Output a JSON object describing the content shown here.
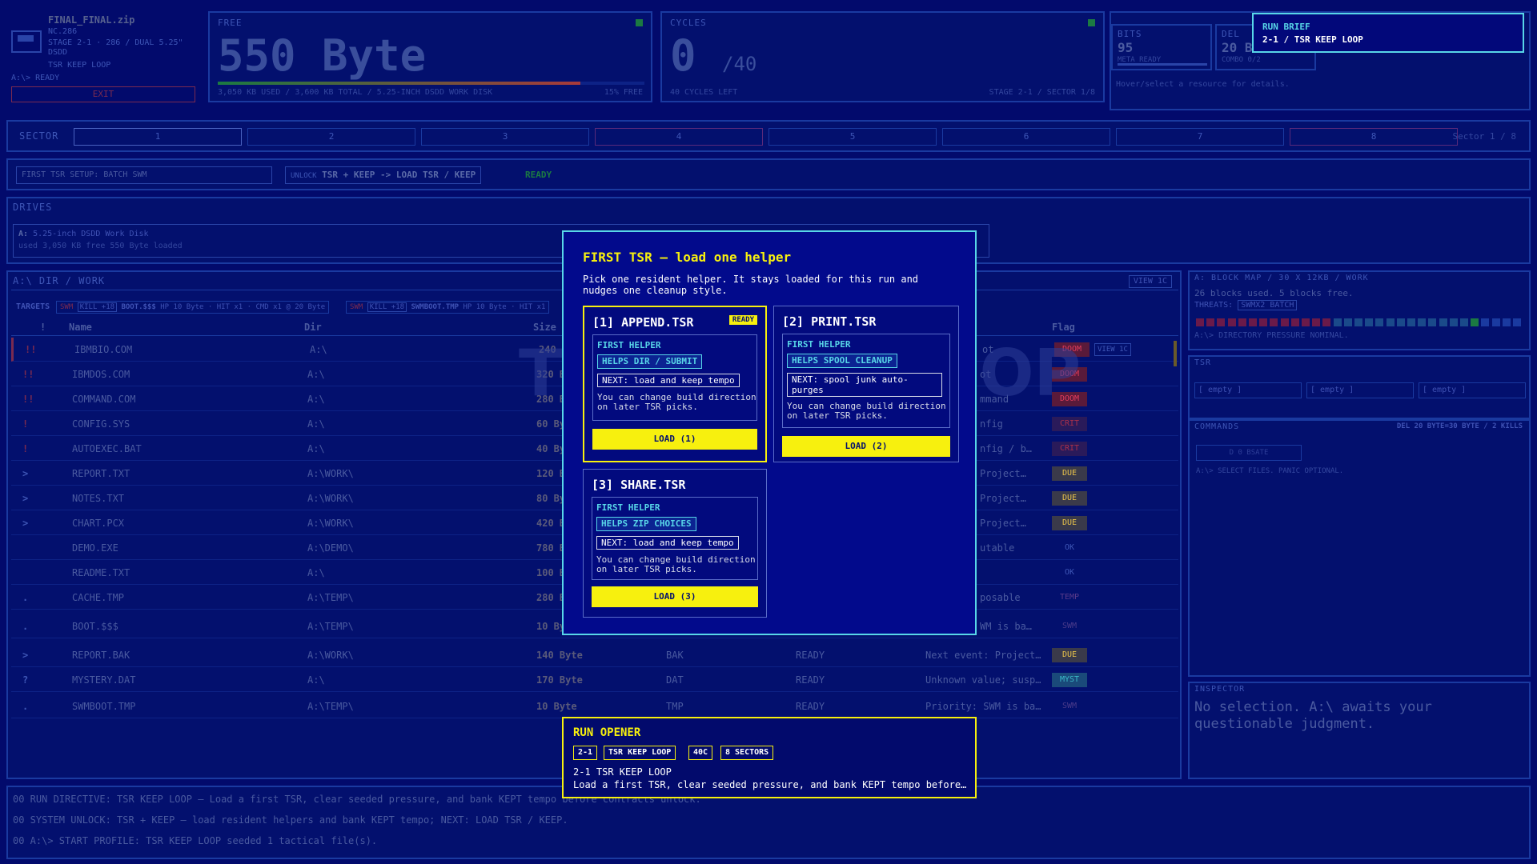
{
  "file": {
    "name": "FINAL_FINAL.zip",
    "code": "NC.286",
    "stage": "STAGE 2-1 · 286 / DUAL 5.25\" DSDD",
    "mode": "TSR KEEP LOOP",
    "prompt": "A:\\> READY",
    "exit": "EXIT"
  },
  "free": {
    "label": "FREE",
    "value": "550 Byte",
    "used": "3,050 KB USED / 3,600 KB TOTAL / 5.25-INCH DSDD WORK DISK",
    "pct": "15% FREE",
    "fill_pct": 85
  },
  "cycles": {
    "label": "CYCLES",
    "value": "0",
    "max": "/40",
    "left": "40 CYCLES LEFT",
    "stage": "STAGE 2-1 / SECTOR 1/8"
  },
  "bits": {
    "label": "BITS",
    "value": "95",
    "sub": "META READY"
  },
  "del": {
    "label": "DEL",
    "value": "20 B",
    "sub": "COMBO 0/2"
  },
  "hover_hint": "Hover/select a resource for details.",
  "brief": {
    "title": "RUN BRIEF",
    "sub": "2-1 / TSR KEEP LOOP"
  },
  "sector": {
    "label": "SECTOR",
    "items": [
      "1",
      "2",
      "3",
      "4",
      "5",
      "6",
      "7",
      "8"
    ],
    "marked": [
      "4",
      "8"
    ],
    "status": "Sector 1 / 8"
  },
  "setup": {
    "field": "FIRST TSR SETUP: BATCH SWM",
    "unlock_prefix": "UNLOCK",
    "unlock": "TSR + KEEP -> LOAD TSR / KEEP",
    "ready": "READY"
  },
  "drives": {
    "title": "DRIVES",
    "drive": "A:",
    "desc": "5.25-inch DSDD Work Disk",
    "usage": "used 3,050 KB  free 550 Byte  loaded"
  },
  "dir": {
    "title": "A:\\ DIR / WORK",
    "view": "VIEW 1C",
    "targets_label": "TARGETS",
    "targets": [
      {
        "tag": "SWM",
        "kill": "KILL +18",
        "name": "BOOT.$$$",
        "info": "HP 10 Byte · HIT x1 · CMD x1 @ 20 Byte"
      },
      {
        "tag": "SWM",
        "kill": "KILL +18",
        "name": "SWMBOOT.TMP",
        "info": "HP 10 Byte · HIT x1"
      }
    ],
    "columns": {
      "bang": "!",
      "name": "Name",
      "dir": "Dir",
      "size": "Size",
      "flag": "Flag"
    },
    "rows": [
      {
        "mark": "!!",
        "name": "IBMBIO.COM",
        "dir": "A:\\",
        "size": "240 B",
        "type": "",
        "state": "",
        "note": "ot",
        "flag": "DOOM",
        "extra": "VIEW 1C"
      },
      {
        "mark": "!!",
        "name": "IBMDOS.COM",
        "dir": "A:\\",
        "size": "320 By",
        "type": "",
        "state": "",
        "note": "ot",
        "flag": "DOOM",
        "extra": ""
      },
      {
        "mark": "!!",
        "name": "COMMAND.COM",
        "dir": "A:\\",
        "size": "280 By",
        "type": "",
        "state": "",
        "note": "mmand",
        "flag": "DOOM",
        "extra": ""
      },
      {
        "mark": "!",
        "name": "CONFIG.SYS",
        "dir": "A:\\",
        "size": "60 By",
        "type": "",
        "state": "",
        "note": "nfig",
        "flag": "CRIT",
        "extra": ""
      },
      {
        "mark": "!",
        "name": "AUTOEXEC.BAT",
        "dir": "A:\\",
        "size": "40 By",
        "type": "",
        "state": "",
        "note": "nfig / b…",
        "flag": "CRIT",
        "extra": ""
      },
      {
        "mark": ">",
        "name": "REPORT.TXT",
        "dir": "A:\\WORK\\",
        "size": "120 By",
        "type": "",
        "state": "",
        "note": "Project…",
        "flag": "DUE",
        "extra": ""
      },
      {
        "mark": ">",
        "name": "NOTES.TXT",
        "dir": "A:\\WORK\\",
        "size": "80 By",
        "type": "",
        "state": "",
        "note": "Project…",
        "flag": "DUE",
        "extra": ""
      },
      {
        "mark": ">",
        "name": "CHART.PCX",
        "dir": "A:\\WORK\\",
        "size": "420 By",
        "type": "",
        "state": "",
        "note": "Project…",
        "flag": "DUE",
        "extra": ""
      },
      {
        "mark": "",
        "name": "DEMO.EXE",
        "dir": "A:\\DEMO\\",
        "size": "780 By",
        "type": "",
        "state": "",
        "note": "utable",
        "flag": "OK",
        "extra": ""
      },
      {
        "mark": "",
        "name": "README.TXT",
        "dir": "A:\\",
        "size": "100 By",
        "type": "",
        "state": "",
        "note": "",
        "flag": "OK",
        "extra": ""
      },
      {
        "mark": ".",
        "name": "CACHE.TMP",
        "dir": "A:\\TEMP\\",
        "size": "280 By",
        "type": "",
        "state": "",
        "note": "posable",
        "flag": "TEMP",
        "extra": ""
      },
      {
        "mark": ".",
        "name": "BOOT.$$$",
        "dir": "A:\\TEMP\\",
        "size": "10 By",
        "type": "",
        "state": "",
        "note": "WM is ba…",
        "flag": "SWM",
        "extra": ""
      },
      {
        "mark": ">",
        "name": "REPORT.BAK",
        "dir": "A:\\WORK\\",
        "size": "140 Byte",
        "type": "BAK",
        "state": "READY",
        "note": "Next event: Project…",
        "flag": "DUE",
        "extra": ""
      },
      {
        "mark": "?",
        "name": "MYSTERY.DAT",
        "dir": "A:\\",
        "size": "170 Byte",
        "type": "DAT",
        "state": "READY",
        "note": "Unknown value; susp…",
        "flag": "MYST",
        "extra": ""
      },
      {
        "mark": ".",
        "name": "SWMBOOT.TMP",
        "dir": "A:\\TEMP\\",
        "size": "10 Byte",
        "type": "TMP",
        "state": "READY",
        "note": "Priority: SWM is ba…",
        "flag": "SWM",
        "extra": ""
      }
    ]
  },
  "blockmap": {
    "title": "A: BLOCK MAP / 30 X 12KB / WORK",
    "used": "26 blocks used. 5 blocks free.",
    "threats_label": "THREATS:",
    "threat": "SWMX2 BATCH",
    "status": "A:\\> DIRECTORY PRESSURE NOMINAL."
  },
  "tsr": {
    "title": "TSR",
    "slots": [
      "[ empty ]",
      "[ empty ]",
      "[ empty ]"
    ]
  },
  "commands": {
    "title": "COMMANDS",
    "del": "DEL 20 BYTE=30 BYTE / 2 KILLS",
    "button": "D 0 BSATE",
    "hint": "A:\\> SELECT FILES. PANIC OPTIONAL."
  },
  "inspector": {
    "title": "INSPECTOR",
    "text": "No selection. A:\\ awaits your questionable judgment."
  },
  "log": [
    "00 RUN DIRECTIVE: TSR KEEP LOOP — Load a first TSR, clear seeded pressure, and bank KEPT tempo before contracts unlock.",
    "00 SYSTEM UNLOCK: TSR + KEEP — load resident helpers and bank KEPT tempo; NEXT: LOAD TSR / KEEP.",
    "00 A:\\> START PROFILE: TSR KEEP LOOP seeded 1 tactical file(s)."
  ],
  "watermark": "TSR KEEP LOOP",
  "modal": {
    "title": "FIRST TSR — load one helper",
    "intro": "Pick one resident helper. It stays loaded for this run and nudges one cleanup style.",
    "cards": [
      {
        "title": "[1] APPEND.TSR",
        "badge": "READY",
        "head": "FIRST HELPER",
        "help": "HELPS DIR / SUBMIT",
        "next": "NEXT: load and keep tempo",
        "desc": "You can change build direction on later TSR picks.",
        "load": "LOAD (1)"
      },
      {
        "title": "[2] PRINT.TSR",
        "badge": "",
        "head": "FIRST HELPER",
        "help": "HELPS SPOOL CLEANUP",
        "next": "NEXT: spool junk auto-purges",
        "desc": "You can change build direction on later TSR picks.",
        "load": "LOAD (2)"
      },
      {
        "title": "[3] SHARE.TSR",
        "badge": "",
        "head": "FIRST HELPER",
        "help": "HELPS ZIP CHOICES",
        "next": "NEXT: load and keep tempo",
        "desc": "You can change build direction on later TSR picks.",
        "load": "LOAD (3)"
      }
    ]
  },
  "opener": {
    "title": "RUN OPENER",
    "chips": [
      "2-1",
      "TSR KEEP LOOP",
      "40C",
      "8 SECTORS"
    ],
    "line1": "2-1 TSR KEEP LOOP",
    "line2": "Load a first TSR, clear seeded pressure, and bank KEPT tempo before…"
  },
  "colors": {
    "accent": "#58d6e8",
    "yellow": "#f7f00e",
    "doom": "#e23c5c",
    "due": "#e8c34a",
    "myst": "#3ab8c8",
    "bg": "#020a6c"
  }
}
